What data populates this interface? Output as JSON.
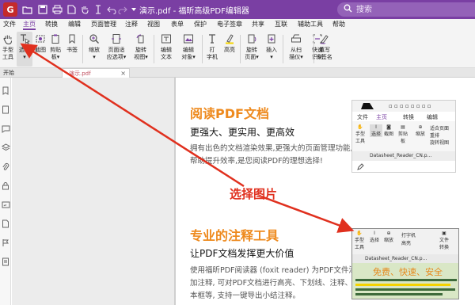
{
  "app": {
    "title": "演示.pdf - 福昕高级PDF编辑器",
    "logo_glyph": "G"
  },
  "search": {
    "placeholder": "搜索"
  },
  "menu": {
    "items": [
      "文件",
      "主页",
      "转换",
      "编辑",
      "页面管理",
      "注释",
      "视图",
      "表单",
      "保护",
      "电子签章",
      "共享",
      "互联",
      "辅助工具",
      "帮助"
    ],
    "active": "主页"
  },
  "ribbon": {
    "buttons": [
      {
        "l1": "手型",
        "l2": "工具",
        "icon": "hand-icon"
      },
      {
        "l1": "选择",
        "l2": "▾",
        "icon": "select-text-icon"
      },
      {
        "l1": "截图",
        "l2": "",
        "icon": "snapshot-icon"
      },
      {
        "l1": "剪贴",
        "l2": "板▾",
        "icon": "clipboard-icon"
      },
      {
        "l1": "书签",
        "l2": "",
        "icon": "bookmark-icon"
      },
      {
        "l1": "缩放",
        "l2": "▾",
        "icon": "zoom-icon"
      },
      {
        "l1": "页面适",
        "l2": "应选项▾",
        "icon": "fit-page-icon"
      },
      {
        "l1": "旋转",
        "l2": "视图▾",
        "icon": "rotate-view-icon"
      },
      {
        "l1": "编辑",
        "l2": "文本",
        "icon": "edit-text-icon"
      },
      {
        "l1": "编辑",
        "l2": "对象▾",
        "icon": "edit-object-icon"
      },
      {
        "l1": "打",
        "l2": "字机",
        "icon": "typewriter-icon"
      },
      {
        "l1": "高亮",
        "l2": "",
        "icon": "highlight-icon"
      },
      {
        "l1": "旋转",
        "l2": "页面▾",
        "icon": "rotate-page-icon"
      },
      {
        "l1": "插入",
        "l2": "▾",
        "icon": "insert-icon"
      },
      {
        "l1": "从扫",
        "l2": "描仪▾",
        "icon": "scanner-icon"
      },
      {
        "l1": "快速",
        "l2": "识别",
        "icon": "ocr-icon"
      },
      {
        "l1": "填写",
        "l2": "&签名",
        "icon": "fill-sign-icon"
      }
    ]
  },
  "tabs": {
    "start_label": "开始",
    "doc_tab": "演示.pdf",
    "close_glyph": "×"
  },
  "document": {
    "section1_title": "阅读PDF文档",
    "section1_subtitle": "更强大、更实用、更高效",
    "section1_line1": "拥有出色的文档渲染效果,更强大的页面管理功能,",
    "section1_line2": "帮助提升效率,是您阅读PDF的理想选择!",
    "section2_title": "专业的注释工具",
    "section2_subtitle": "让PDF文档发挥更大价值",
    "section2_line1": "使用福昕PDF阅读器 (foxit reader) 为PDF文件添",
    "section2_line2": "加注释, 可对PDF文档进行高亮、下划线、注释、文",
    "section2_line3": "本框等, 支持一键导出小结注释。"
  },
  "thumb1": {
    "menu": [
      "文件",
      "主页",
      "转换",
      "编辑"
    ],
    "buttons": [
      {
        "l1": "手型",
        "l2": "工具"
      },
      {
        "l1": "选择",
        "l2": ""
      },
      {
        "l1": "截图",
        "l2": ""
      },
      {
        "l1": "剪贴",
        "l2": "板"
      },
      {
        "l1": "缩放",
        "l2": ""
      }
    ],
    "side_items": [
      "适合页面",
      "重排",
      "旋转视图"
    ],
    "filename": "Datasheet_Reader_CN.p..."
  },
  "thumb2": {
    "buttons": [
      {
        "l1": "手型",
        "l2": "工具"
      },
      {
        "l1": "选择",
        "l2": ""
      },
      {
        "l1": "缩放",
        "l2": ""
      },
      {
        "l1": "文件",
        "l2": "转换"
      }
    ],
    "toolbar_items": [
      "打字机",
      "高亮"
    ],
    "filename": "Datasheet_Reader_CN.p...",
    "banner": "免费、快速、安全"
  },
  "annotation": {
    "label": "选择图片",
    "color": "#e0301e"
  },
  "colors": {
    "brand": "#7a3fa3",
    "heading": "#ee8a1e"
  }
}
